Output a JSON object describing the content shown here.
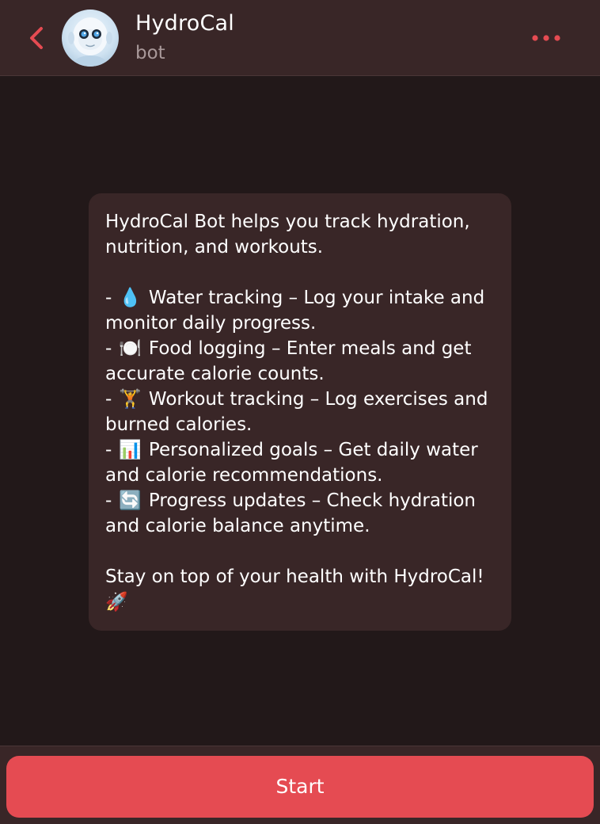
{
  "header": {
    "title": "HydroCal",
    "subtitle": "bot",
    "back_icon": "chevron-left-icon",
    "more_icon": "more-dots-icon",
    "accent": "#e54b52"
  },
  "message": {
    "intro": "HydroCal Bot helps you track hydration, nutrition, and workouts.",
    "features": [
      {
        "prefix": "- ",
        "emoji": "💧",
        "text": " Water tracking – Log your intake and monitor daily progress."
      },
      {
        "prefix": "- ",
        "emoji": "🍽️",
        "text": " Food logging – Enter meals and get accurate calorie counts."
      },
      {
        "prefix": "- ",
        "emoji": "🏋️",
        "text": " Workout tracking – Log exercises and burned calories."
      },
      {
        "prefix": "- ",
        "emoji": "📊",
        "text": " Personalized goals – Get daily water and calorie recommendations."
      },
      {
        "prefix": "- ",
        "emoji": "🔄",
        "text": " Progress updates – Check hydration and calorie balance anytime."
      }
    ],
    "outro_text": "Stay on top of your health with HydroCal! ",
    "outro_emoji": "🚀"
  },
  "footer": {
    "start_label": "Start"
  }
}
